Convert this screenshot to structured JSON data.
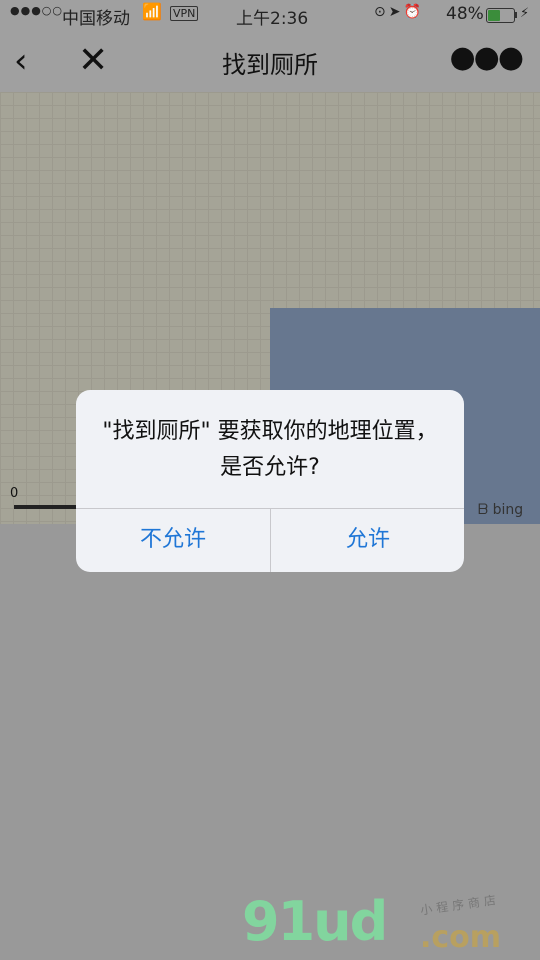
{
  "status_bar": {
    "signal": "●●●○○",
    "carrier": "中国移动",
    "vpn": "VPN",
    "time": "上午2:36",
    "battery_percent": "48%",
    "battery_level": 0.48
  },
  "nav": {
    "title": "找到厕所",
    "back_icon": "chevron-left-icon",
    "close_icon": "close-icon",
    "more_icon": "more-dots-icon"
  },
  "map": {
    "scale_label": "0",
    "provider": "bing"
  },
  "dialog": {
    "message": "\"找到厕所\" 要获取你的地理位置，是否允许?",
    "deny_label": "不允许",
    "allow_label": "允许",
    "accent_color": "#1f76d6"
  },
  "watermark": {
    "brand": "91ud",
    "domain": ".com",
    "tagline": "小程序商店"
  }
}
